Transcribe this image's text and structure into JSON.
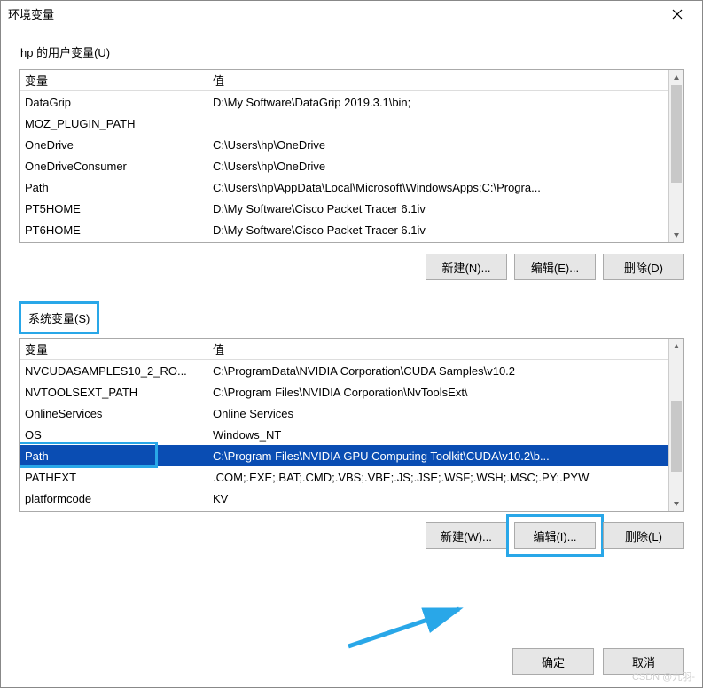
{
  "window": {
    "title": "环境变量"
  },
  "userVars": {
    "label": "hp 的用户变量(U)",
    "columns": {
      "var": "变量",
      "val": "值"
    },
    "rows": [
      {
        "var": "DataGrip",
        "val": "D:\\My Software\\DataGrip 2019.3.1\\bin;"
      },
      {
        "var": "MOZ_PLUGIN_PATH",
        "val": ""
      },
      {
        "var": "OneDrive",
        "val": "C:\\Users\\hp\\OneDrive"
      },
      {
        "var": "OneDriveConsumer",
        "val": "C:\\Users\\hp\\OneDrive"
      },
      {
        "var": "Path",
        "val": "C:\\Users\\hp\\AppData\\Local\\Microsoft\\WindowsApps;C:\\Progra..."
      },
      {
        "var": "PT5HOME",
        "val": "D:\\My Software\\Cisco Packet Tracer 6.1iv"
      },
      {
        "var": "PT6HOME",
        "val": "D:\\My Software\\Cisco Packet Tracer 6.1iv"
      }
    ],
    "buttons": {
      "new": "新建(N)...",
      "edit": "编辑(E)...",
      "del": "删除(D)"
    }
  },
  "systemVars": {
    "label": "系统变量(S)",
    "columns": {
      "var": "变量",
      "val": "值"
    },
    "rows": [
      {
        "var": "NVCUDASAMPLES10_2_RO...",
        "val": "C:\\ProgramData\\NVIDIA Corporation\\CUDA Samples\\v10.2"
      },
      {
        "var": "NVTOOLSEXT_PATH",
        "val": "C:\\Program Files\\NVIDIA Corporation\\NvToolsExt\\"
      },
      {
        "var": "OnlineServices",
        "val": "Online Services"
      },
      {
        "var": "OS",
        "val": "Windows_NT"
      },
      {
        "var": "Path",
        "val": "C:\\Program Files\\NVIDIA GPU Computing Toolkit\\CUDA\\v10.2\\b...",
        "selected": true
      },
      {
        "var": "PATHEXT",
        "val": ".COM;.EXE;.BAT;.CMD;.VBS;.VBE;.JS;.JSE;.WSF;.WSH;.MSC;.PY;.PYW"
      },
      {
        "var": "platformcode",
        "val": "KV"
      }
    ],
    "buttons": {
      "new": "新建(W)...",
      "edit": "编辑(I)...",
      "del": "删除(L)"
    }
  },
  "dialog": {
    "ok": "确定",
    "cancel": "取消"
  },
  "watermark": "CSDN @九羽-"
}
